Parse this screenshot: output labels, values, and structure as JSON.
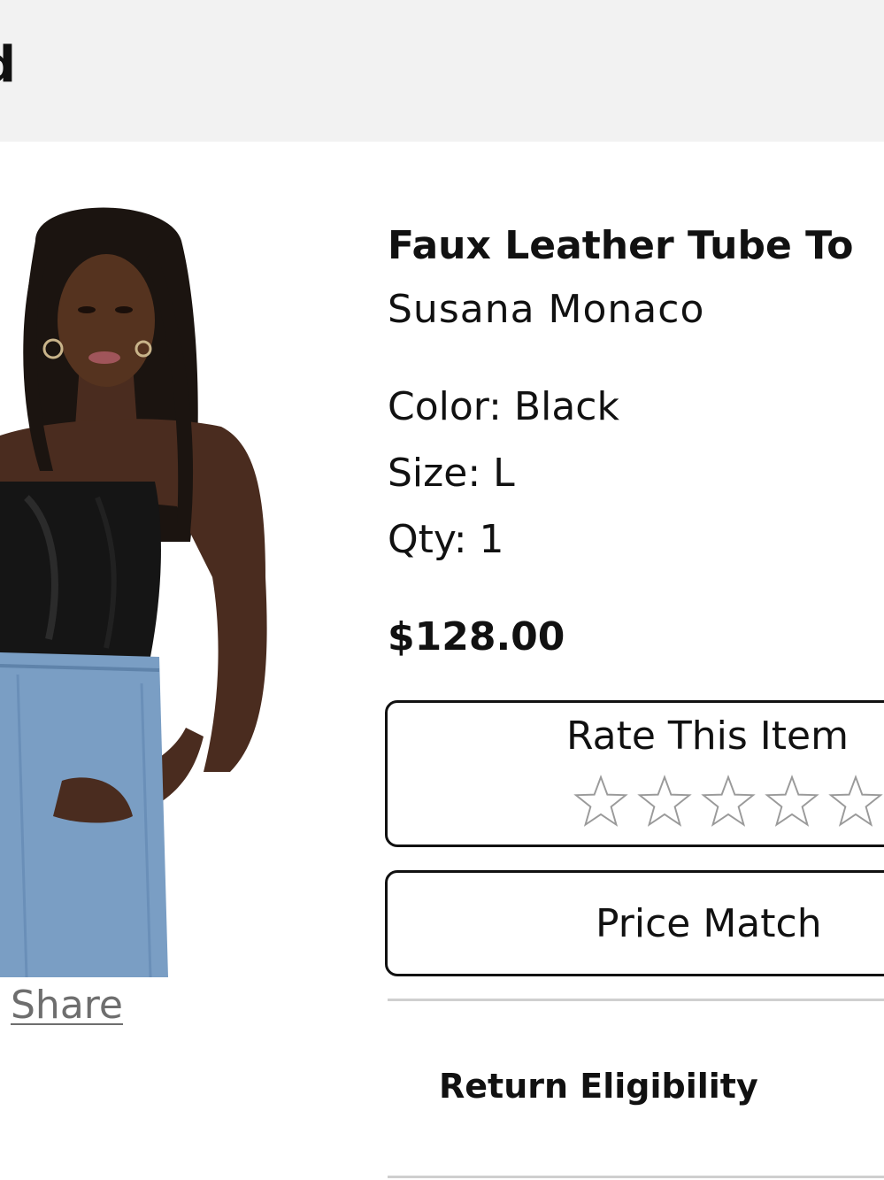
{
  "header": {
    "title_fragment": "d"
  },
  "product": {
    "image_alt": "Model wearing black faux leather tube top with blue jeans",
    "share_label": "Share",
    "title": "Faux Leather Tube To",
    "brand": "Susana Monaco",
    "color_label": "Color: Black",
    "size_label": "Size: L",
    "qty_label": "Qty: 1",
    "price": "$128.00"
  },
  "rating": {
    "title": "Rate This Item",
    "max_stars": 5,
    "current_rating": 0,
    "star_icon": "star-outline-icon"
  },
  "actions": {
    "price_match_label": "Price Match",
    "return_eligibility_label": "Return Eligibility"
  },
  "colors": {
    "header_bg": "#f2f2f2",
    "text": "#111111",
    "share_link": "#6e6e6e",
    "divider": "#cfcfcf",
    "star_outline": "#9a9a9a"
  }
}
